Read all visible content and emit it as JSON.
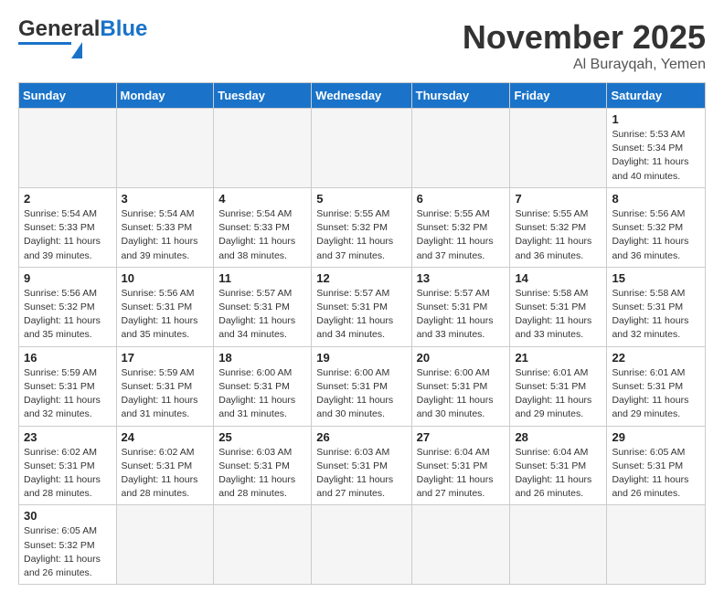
{
  "header": {
    "logo_general": "General",
    "logo_blue": "Blue",
    "month_title": "November 2025",
    "location": "Al Burayqah, Yemen"
  },
  "weekdays": [
    "Sunday",
    "Monday",
    "Tuesday",
    "Wednesday",
    "Thursday",
    "Friday",
    "Saturday"
  ],
  "days": [
    {
      "num": "",
      "info": "",
      "empty": true
    },
    {
      "num": "",
      "info": "",
      "empty": true
    },
    {
      "num": "",
      "info": "",
      "empty": true
    },
    {
      "num": "",
      "info": "",
      "empty": true
    },
    {
      "num": "",
      "info": "",
      "empty": true
    },
    {
      "num": "",
      "info": "",
      "empty": true
    },
    {
      "num": "1",
      "info": "Sunrise: 5:53 AM\nSunset: 5:34 PM\nDaylight: 11 hours\nand 40 minutes."
    },
    {
      "num": "2",
      "info": "Sunrise: 5:54 AM\nSunset: 5:33 PM\nDaylight: 11 hours\nand 39 minutes."
    },
    {
      "num": "3",
      "info": "Sunrise: 5:54 AM\nSunset: 5:33 PM\nDaylight: 11 hours\nand 39 minutes."
    },
    {
      "num": "4",
      "info": "Sunrise: 5:54 AM\nSunset: 5:33 PM\nDaylight: 11 hours\nand 38 minutes."
    },
    {
      "num": "5",
      "info": "Sunrise: 5:55 AM\nSunset: 5:32 PM\nDaylight: 11 hours\nand 37 minutes."
    },
    {
      "num": "6",
      "info": "Sunrise: 5:55 AM\nSunset: 5:32 PM\nDaylight: 11 hours\nand 37 minutes."
    },
    {
      "num": "7",
      "info": "Sunrise: 5:55 AM\nSunset: 5:32 PM\nDaylight: 11 hours\nand 36 minutes."
    },
    {
      "num": "8",
      "info": "Sunrise: 5:56 AM\nSunset: 5:32 PM\nDaylight: 11 hours\nand 36 minutes."
    },
    {
      "num": "9",
      "info": "Sunrise: 5:56 AM\nSunset: 5:32 PM\nDaylight: 11 hours\nand 35 minutes."
    },
    {
      "num": "10",
      "info": "Sunrise: 5:56 AM\nSunset: 5:31 PM\nDaylight: 11 hours\nand 35 minutes."
    },
    {
      "num": "11",
      "info": "Sunrise: 5:57 AM\nSunset: 5:31 PM\nDaylight: 11 hours\nand 34 minutes."
    },
    {
      "num": "12",
      "info": "Sunrise: 5:57 AM\nSunset: 5:31 PM\nDaylight: 11 hours\nand 34 minutes."
    },
    {
      "num": "13",
      "info": "Sunrise: 5:57 AM\nSunset: 5:31 PM\nDaylight: 11 hours\nand 33 minutes."
    },
    {
      "num": "14",
      "info": "Sunrise: 5:58 AM\nSunset: 5:31 PM\nDaylight: 11 hours\nand 33 minutes."
    },
    {
      "num": "15",
      "info": "Sunrise: 5:58 AM\nSunset: 5:31 PM\nDaylight: 11 hours\nand 32 minutes."
    },
    {
      "num": "16",
      "info": "Sunrise: 5:59 AM\nSunset: 5:31 PM\nDaylight: 11 hours\nand 32 minutes."
    },
    {
      "num": "17",
      "info": "Sunrise: 5:59 AM\nSunset: 5:31 PM\nDaylight: 11 hours\nand 31 minutes."
    },
    {
      "num": "18",
      "info": "Sunrise: 6:00 AM\nSunset: 5:31 PM\nDaylight: 11 hours\nand 31 minutes."
    },
    {
      "num": "19",
      "info": "Sunrise: 6:00 AM\nSunset: 5:31 PM\nDaylight: 11 hours\nand 30 minutes."
    },
    {
      "num": "20",
      "info": "Sunrise: 6:00 AM\nSunset: 5:31 PM\nDaylight: 11 hours\nand 30 minutes."
    },
    {
      "num": "21",
      "info": "Sunrise: 6:01 AM\nSunset: 5:31 PM\nDaylight: 11 hours\nand 29 minutes."
    },
    {
      "num": "22",
      "info": "Sunrise: 6:01 AM\nSunset: 5:31 PM\nDaylight: 11 hours\nand 29 minutes."
    },
    {
      "num": "23",
      "info": "Sunrise: 6:02 AM\nSunset: 5:31 PM\nDaylight: 11 hours\nand 28 minutes."
    },
    {
      "num": "24",
      "info": "Sunrise: 6:02 AM\nSunset: 5:31 PM\nDaylight: 11 hours\nand 28 minutes."
    },
    {
      "num": "25",
      "info": "Sunrise: 6:03 AM\nSunset: 5:31 PM\nDaylight: 11 hours\nand 28 minutes."
    },
    {
      "num": "26",
      "info": "Sunrise: 6:03 AM\nSunset: 5:31 PM\nDaylight: 11 hours\nand 27 minutes."
    },
    {
      "num": "27",
      "info": "Sunrise: 6:04 AM\nSunset: 5:31 PM\nDaylight: 11 hours\nand 27 minutes."
    },
    {
      "num": "28",
      "info": "Sunrise: 6:04 AM\nSunset: 5:31 PM\nDaylight: 11 hours\nand 26 minutes."
    },
    {
      "num": "29",
      "info": "Sunrise: 6:05 AM\nSunset: 5:31 PM\nDaylight: 11 hours\nand 26 minutes."
    },
    {
      "num": "30",
      "info": "Sunrise: 6:05 AM\nSunset: 5:32 PM\nDaylight: 11 hours\nand 26 minutes."
    },
    {
      "num": "",
      "info": "",
      "empty": true
    },
    {
      "num": "",
      "info": "",
      "empty": true
    },
    {
      "num": "",
      "info": "",
      "empty": true
    },
    {
      "num": "",
      "info": "",
      "empty": true
    },
    {
      "num": "",
      "info": "",
      "empty": true
    },
    {
      "num": "",
      "info": "",
      "empty": true
    }
  ]
}
